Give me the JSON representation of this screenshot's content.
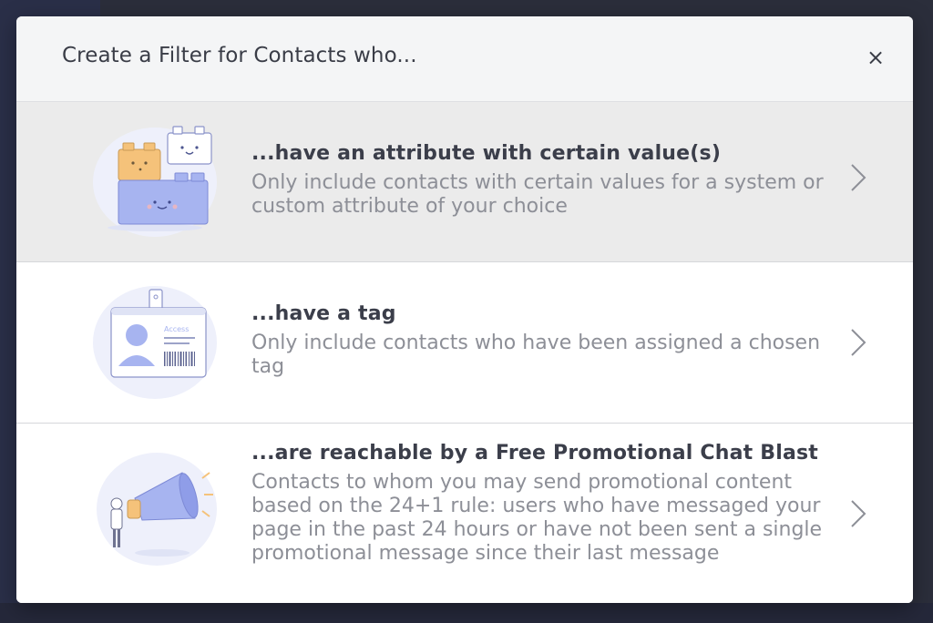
{
  "modal": {
    "title": "Create a Filter for Contacts who...",
    "close_label": "×"
  },
  "options": [
    {
      "title": "...have an attribute with certain value(s)",
      "description": "Only include contacts with certain values for a system or custom attribute of your choice",
      "icon": "blocks-illustration"
    },
    {
      "title": "...have a tag",
      "description": "Only include contacts who have been assigned a chosen tag",
      "icon": "badge-illustration",
      "badge_text": "Access"
    },
    {
      "title": "...are reachable by a Free Promotional Chat Blast",
      "description": "Contacts to whom you may send promotional content based on the 24+1 rule: users who have messaged your page in the past 24 hours or have not been sent a single promotional message since their last message",
      "icon": "megaphone-illustration"
    }
  ],
  "colors": {
    "overlay": "#2b2e3b",
    "hover_row": "#ebebeb",
    "title_text": "#3b3e4a",
    "desc_text": "#8d8f97",
    "illustration_blue": "#a7b4f0",
    "illustration_orange": "#f5c27a"
  }
}
